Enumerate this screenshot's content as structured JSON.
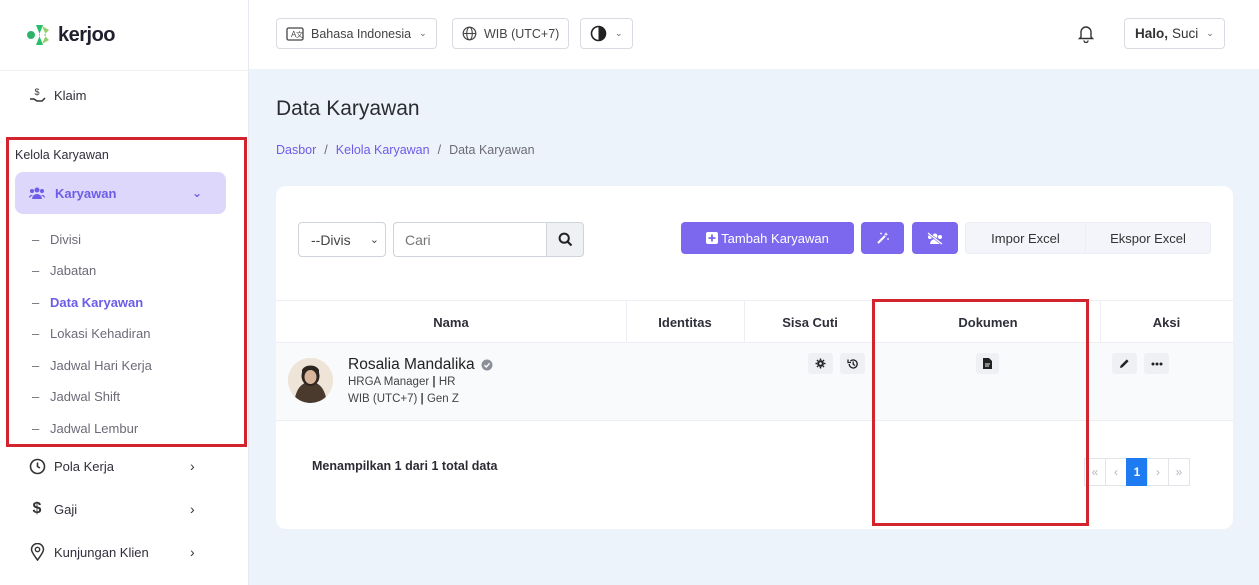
{
  "app": {
    "logo_text": "kerjoo"
  },
  "topbar": {
    "language": "Bahasa Indonesia",
    "timezone": "WIB (UTC+7)",
    "greeting_bold": "Halo,",
    "user_name": "Suci"
  },
  "sidebar": {
    "klaim": "Klaim",
    "section_title": "Kelola Karyawan",
    "active_parent": "Karyawan",
    "sub_items": [
      "Divisi",
      "Jabatan",
      "Data Karyawan",
      "Lokasi Kehadiran",
      "Jadwal Hari Kerja",
      "Jadwal Shift",
      "Jadwal Lembur"
    ],
    "pola_kerja": "Pola Kerja",
    "gaji": "Gaji",
    "kunjungan": "Kunjungan Klien"
  },
  "page": {
    "title": "Data Karyawan",
    "breadcrumb": [
      "Dasbor",
      "Kelola Karyawan",
      "Data Karyawan"
    ]
  },
  "filters": {
    "division_value": "--Divis",
    "search_placeholder": "Cari"
  },
  "actions": {
    "add_employee": "Tambah Karyawan",
    "import_excel": "Impor Excel",
    "export_excel": "Ekspor Excel"
  },
  "table": {
    "headers": [
      "Nama",
      "Identitas",
      "Sisa Cuti",
      "Dokumen",
      "Aksi"
    ],
    "rows": [
      {
        "name": "Rosalia Mandalika",
        "position": "HRGA Manager",
        "division": "HR",
        "timezone": "WIB (UTC+7)",
        "group": "Gen Z"
      }
    ]
  },
  "footer": {
    "summary": "Menampilkan 1 dari 1 total data",
    "pages": [
      "«",
      "‹",
      "1",
      "›",
      "»"
    ],
    "current_page": "1"
  },
  "colors": {
    "accent": "#7b68ee",
    "highlight_box": "#d3232f",
    "active_page": "#1e7bf2"
  }
}
